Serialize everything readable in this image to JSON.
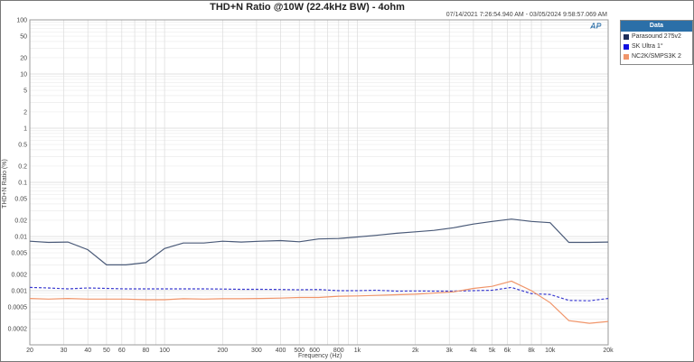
{
  "chart_data": {
    "type": "line",
    "title": "THD+N Ratio @10W (22.4kHz BW) - 4ohm",
    "subtitle": "07/14/2021 7:26:54.940 AM - 03/05/2024 9:58:57.069 AM",
    "xlabel": "Frequency (Hz)",
    "ylabel": "THD+N Ratio (%)",
    "xscale": "log",
    "yscale": "log",
    "xlim": [
      20,
      20000
    ],
    "ylim": [
      0.0001,
      100
    ],
    "grid": true,
    "legend_title": "Data",
    "legend_position": "right",
    "x_ticks": [
      20,
      30,
      40,
      50,
      60,
      80,
      100,
      200,
      300,
      400,
      500,
      600,
      800,
      1000,
      2000,
      3000,
      4000,
      5000,
      6000,
      8000,
      10000,
      20000
    ],
    "x_tick_labels": [
      "20",
      "30",
      "40",
      "50",
      "60",
      "80",
      "100",
      "200",
      "300",
      "400",
      "500",
      "600",
      "800",
      "1k",
      "2k",
      "3k",
      "4k",
      "5k",
      "6k",
      "8k",
      "10k",
      "20k"
    ],
    "y_ticks": [
      100,
      50,
      20,
      10,
      5,
      2,
      1,
      0.5,
      0.2,
      0.1,
      0.05,
      0.02,
      0.01,
      0.005,
      0.002,
      0.001,
      0.0005,
      0.0002
    ],
    "y_tick_labels": [
      "100",
      "50",
      "20",
      "10",
      "5",
      "2",
      "1",
      "0.5",
      "0.2",
      "0.1",
      "0.05",
      "0.02",
      "0.01",
      "0.005",
      "0.002",
      "0.001",
      "0.0005",
      "0.0002"
    ],
    "x": [
      20,
      25,
      31.5,
      40,
      50,
      63,
      80,
      100,
      125,
      160,
      200,
      250,
      315,
      400,
      500,
      630,
      800,
      1000,
      1250,
      1600,
      2000,
      2500,
      3150,
      4000,
      5000,
      6300,
      8000,
      10000,
      12500,
      16000,
      20000
    ],
    "series": [
      {
        "name": "Parasound 275v2",
        "legend_label": "Parasound 275v2",
        "color": "#4a5a78",
        "dash": false,
        "values": [
          0.0082,
          0.0078,
          0.0079,
          0.0057,
          0.003,
          0.003,
          0.0033,
          0.006,
          0.0076,
          0.0076,
          0.0082,
          0.0079,
          0.0082,
          0.0084,
          0.008,
          0.009,
          0.0092,
          0.0098,
          0.0105,
          0.0115,
          0.0122,
          0.013,
          0.0145,
          0.017,
          0.019,
          0.021,
          0.019,
          0.018,
          0.0078,
          0.0078,
          0.0079
        ]
      },
      {
        "name": "SK Ultra",
        "legend_label": "SK Ultra  1°",
        "color": "#3a3ad0",
        "dash": true,
        "values": [
          0.00115,
          0.00112,
          0.00108,
          0.00112,
          0.0011,
          0.00108,
          0.00108,
          0.00108,
          0.00108,
          0.00108,
          0.00107,
          0.00106,
          0.00106,
          0.00105,
          0.00104,
          0.00105,
          0.001,
          0.001,
          0.00102,
          0.00098,
          0.00099,
          0.00098,
          0.00098,
          0.001,
          0.00102,
          0.00115,
          0.00088,
          0.00085,
          0.00066,
          0.00065,
          0.00072
        ]
      },
      {
        "name": "NC2K/SMPS3K",
        "legend_label": "NC2K/SMPS3K  2",
        "color": "#f0956a",
        "dash": false,
        "values": [
          0.00072,
          0.0007,
          0.00072,
          0.0007,
          0.0007,
          0.0007,
          0.00068,
          0.00068,
          0.00071,
          0.0007,
          0.00071,
          0.00071,
          0.00072,
          0.00073,
          0.00075,
          0.00075,
          0.00079,
          0.0008,
          0.00082,
          0.00084,
          0.00086,
          0.0009,
          0.00095,
          0.0011,
          0.0012,
          0.0015,
          0.001,
          0.0006,
          0.00028,
          0.00025,
          0.00027
        ]
      }
    ],
    "logo_text": "AP"
  }
}
